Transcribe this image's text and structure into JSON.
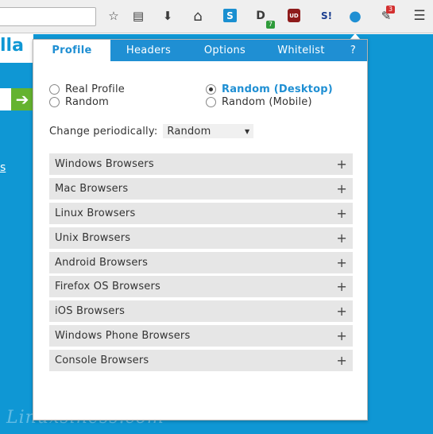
{
  "toolbar": {
    "icons": [
      {
        "name": "bookmark-star-icon",
        "glyph": "☆"
      },
      {
        "name": "reading-list-icon",
        "glyph": "▤"
      },
      {
        "name": "download-icon",
        "glyph": "⬇"
      },
      {
        "name": "home-icon",
        "glyph": "⌂"
      },
      {
        "name": "extension-s-icon",
        "glyph": "S"
      },
      {
        "name": "extension-d-icon",
        "glyph": "D",
        "badge": "7"
      },
      {
        "name": "ublock-icon",
        "glyph": "UD"
      },
      {
        "name": "extension-sl-icon",
        "glyph": "S!"
      },
      {
        "name": "user-agent-switcher-icon",
        "glyph": "●"
      },
      {
        "name": "extension-hat-icon",
        "glyph": "✎",
        "badge": "3"
      },
      {
        "name": "menu-icon",
        "glyph": "☰"
      }
    ],
    "badge_green": "#2e9b3a",
    "badge_red": "#d33030"
  },
  "page": {
    "brand_fragment": "lla",
    "go_arrow": "➔",
    "link_fragment": "s",
    "watermark": "Linuxsiness.com"
  },
  "popup": {
    "tabs": [
      {
        "label": "Profile"
      },
      {
        "label": "Headers"
      },
      {
        "label": "Options"
      },
      {
        "label": "Whitelist"
      },
      {
        "label": "?"
      }
    ],
    "radios": {
      "real_profile": "Real Profile",
      "random": "Random",
      "random_desktop": "Random (Desktop)",
      "random_mobile": "Random (Mobile)",
      "selected": "random_desktop"
    },
    "periodic": {
      "label": "Change periodically:",
      "value": "Random"
    },
    "groups": [
      {
        "label": "Windows Browsers"
      },
      {
        "label": "Mac Browsers"
      },
      {
        "label": "Linux Browsers"
      },
      {
        "label": "Unix Browsers"
      },
      {
        "label": "Android Browsers"
      },
      {
        "label": "Firefox OS Browsers"
      },
      {
        "label": "iOS Browsers"
      },
      {
        "label": "Windows Phone Browsers"
      },
      {
        "label": "Console Browsers"
      }
    ],
    "expand_glyph": "+"
  },
  "colors": {
    "accent": "#1f8fd3",
    "page_blue": "#0f97d4",
    "go_green": "#64b32f"
  }
}
